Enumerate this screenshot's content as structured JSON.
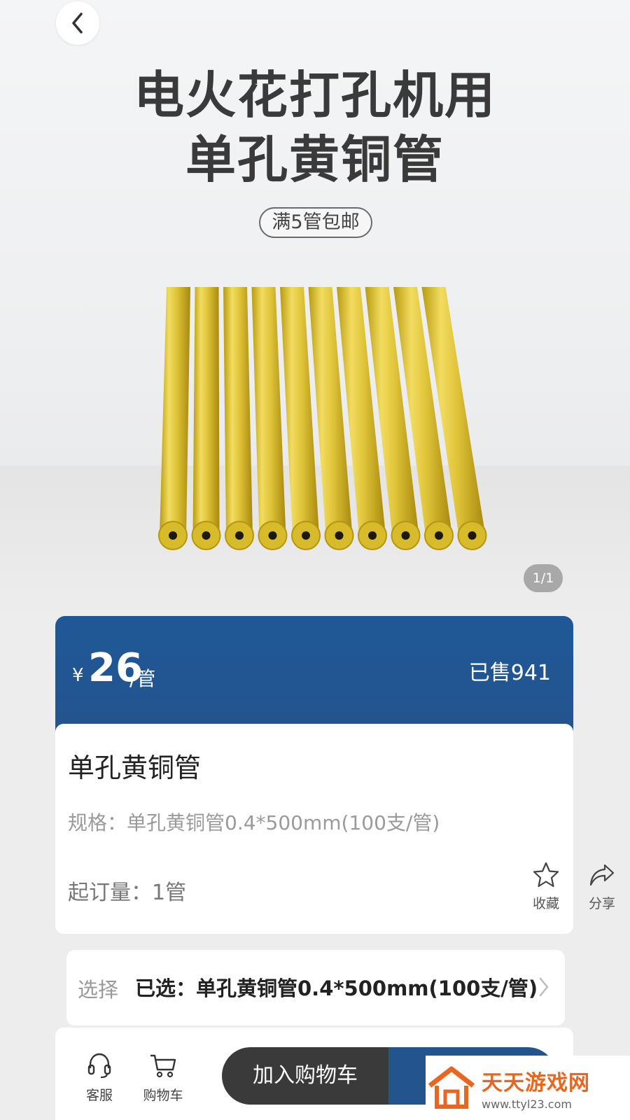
{
  "hero": {
    "title_line1": "电火花打孔机用",
    "title_line2": "单孔黄铜管",
    "promo_tag": "满5管包邮",
    "image_counter": "1/1"
  },
  "price": {
    "currency": "¥",
    "value": "26",
    "unit": "/管",
    "sold": "已售941"
  },
  "product": {
    "name": "单孔黄铜管",
    "spec": "规格：单孔黄铜管0.4*500mm(100支/管)",
    "moq": "起订量：1管",
    "favorite_label": "收藏",
    "share_label": "分享"
  },
  "selection": {
    "label": "选择",
    "value": "已选：单孔黄铜管0.4*500mm(100支/管)"
  },
  "bottom_bar": {
    "service_label": "客服",
    "cart_label": "购物车",
    "add_to_cart": "加入购物车"
  },
  "watermark": {
    "title": "天天游戏网",
    "url": "www.ttyl23.com"
  },
  "colors": {
    "brand_blue": "#24548d",
    "dark_button": "#3a3a3a",
    "brass": "#d8bb2a",
    "watermark_orange": "#e8661f"
  }
}
